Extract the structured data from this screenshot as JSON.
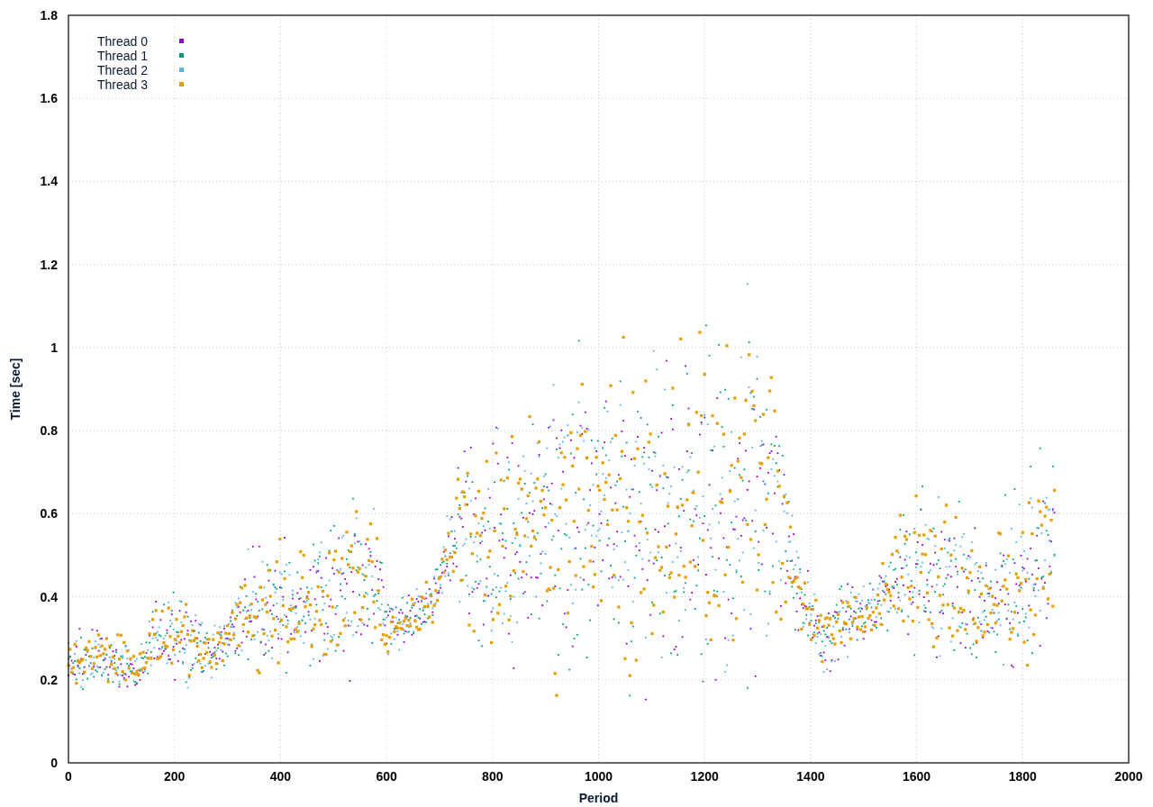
{
  "chart": {
    "ylabel": "Time [sec]",
    "yticks": [
      "1.8",
      "1.6",
      "1.4",
      "1.2",
      "1",
      "0.8",
      "0.6",
      "0.4",
      "0.2",
      "0"
    ],
    "xticks": [
      "0",
      "200",
      "400",
      "600",
      "800",
      "1000",
      "1200",
      "1400",
      "1600",
      "1800",
      "2000"
    ],
    "xlabel": "Period",
    "legend": [
      {
        "label": "Thread 0",
        "color": "#9400d3"
      },
      {
        "label": "Thread 1",
        "color": "#009e73"
      },
      {
        "label": "Thread 2",
        "color": "#56b4e9"
      },
      {
        "label": "Thread 3",
        "color": "#e69f00"
      }
    ]
  }
}
